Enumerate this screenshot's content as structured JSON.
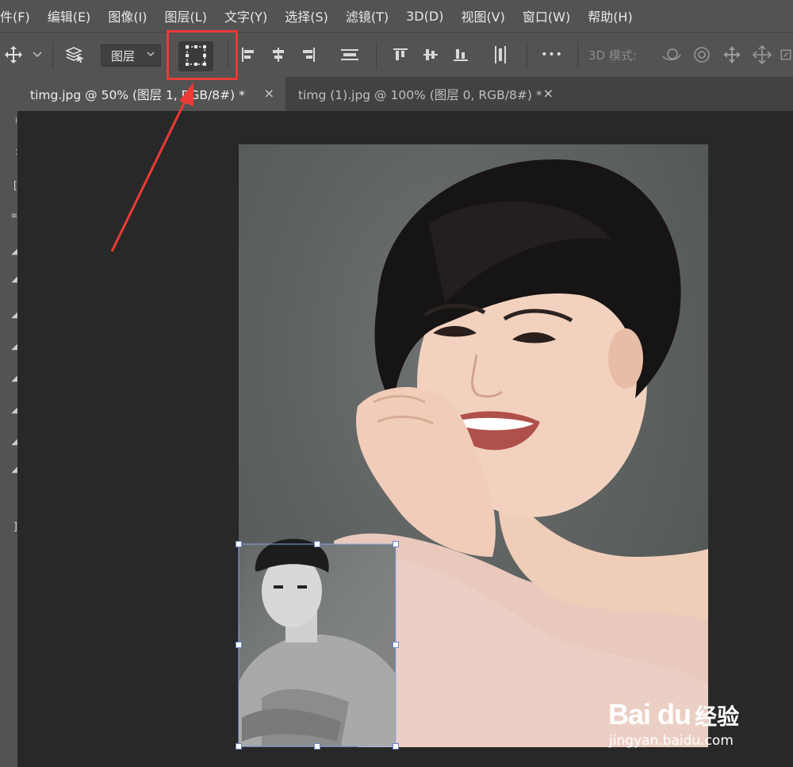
{
  "menubar": {
    "items": [
      "件(F)",
      "编辑(E)",
      "图像(I)",
      "图层(L)",
      "文字(Y)",
      "选择(S)",
      "滤镜(T)",
      "3D(D)",
      "视图(V)",
      "窗口(W)",
      "帮助(H)"
    ]
  },
  "options": {
    "layer_select": "图层",
    "mode_3d_label": "3D 模式:",
    "more_label": "•••"
  },
  "tabs": [
    {
      "label": "timg.jpg @ 50% (图层 1, RGB/8#) *",
      "close": "×",
      "active": true
    },
    {
      "label": "timg (1).jpg @ 100% (图层 0, RGB/8#) *",
      "close": "×",
      "active": false
    }
  ],
  "colors": {
    "highlight": "#ee3a35",
    "transform_handles": "#8aa6e8"
  },
  "icons": [
    "move-icon",
    "dropdown-chevron-icon",
    "layer-stack-icon",
    "transform-controls-icon",
    "align-left-icon",
    "align-hcenter-icon",
    "align-right-icon",
    "distribute-vertical-icon",
    "align-top-icon",
    "align-vcenter-icon",
    "align-bottom-icon",
    "distribute-horizontal-icon",
    "orbit-3d-icon",
    "roll-3d-icon",
    "pan-3d-icon",
    "slide-3d-icon",
    "scale-3d-icon"
  ],
  "watermark": {
    "brand": "Bai du",
    "jingyan": "经验",
    "url": "jingyan.baidu.com"
  }
}
